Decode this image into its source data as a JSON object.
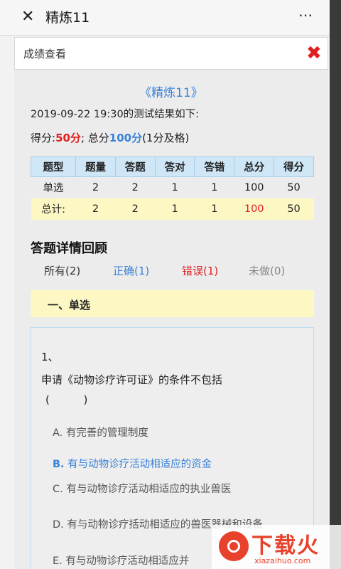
{
  "topbar": {
    "close_glyph": "✕",
    "title": "精炼11",
    "more_glyph": "⋯"
  },
  "panel": {
    "title": "成绩查看",
    "close_glyph": "✖"
  },
  "exam": {
    "title": "《精炼11》",
    "result_line": "2019-09-22 19:30的测试结果如下:",
    "score_label": "得分:",
    "score": "50分",
    "total_label": "; 总分",
    "total": "100分",
    "pass_note": "(1分及格)"
  },
  "stats": {
    "headers": [
      "题型",
      "题量",
      "答题",
      "答对",
      "答错",
      "总分",
      "得分"
    ],
    "row": [
      "单选",
      "2",
      "2",
      "1",
      "1",
      "100",
      "50"
    ],
    "total_row": [
      "总计:",
      "2",
      "2",
      "1",
      "1",
      "100",
      "50"
    ]
  },
  "review": {
    "title": "答题详情回顾",
    "filters": {
      "all": "所有(2)",
      "correct": "正确(1)",
      "wrong": "错误(1)",
      "undone": "未做(0)"
    },
    "section": "一、单选"
  },
  "question": {
    "number": "1、",
    "text": "申请《动物诊疗许可证》的条件不包括",
    "paren": "(          )",
    "options": [
      {
        "letter": "A.",
        "text": "有完善的管理制度"
      },
      {
        "letter": "B.",
        "text": "有与动物诊疗活动相适应的资金"
      },
      {
        "letter": "C.",
        "text": "有与动物诊疗活动相适应的执业兽医"
      },
      {
        "letter": "D.",
        "text": "有与动物诊疗括动相适应的兽医器械和设备"
      },
      {
        "letter": "E.",
        "text": "有与动物诊疗活动相适应并"
      }
    ]
  },
  "watermark": {
    "text": "下载火",
    "sub": "xiazaihuo.com"
  },
  "colors": {
    "accent_blue": "#3a82d8",
    "error_red": "#e02020",
    "highlight_yellow": "#fdf7c4",
    "table_header": "#cfe6f7"
  }
}
